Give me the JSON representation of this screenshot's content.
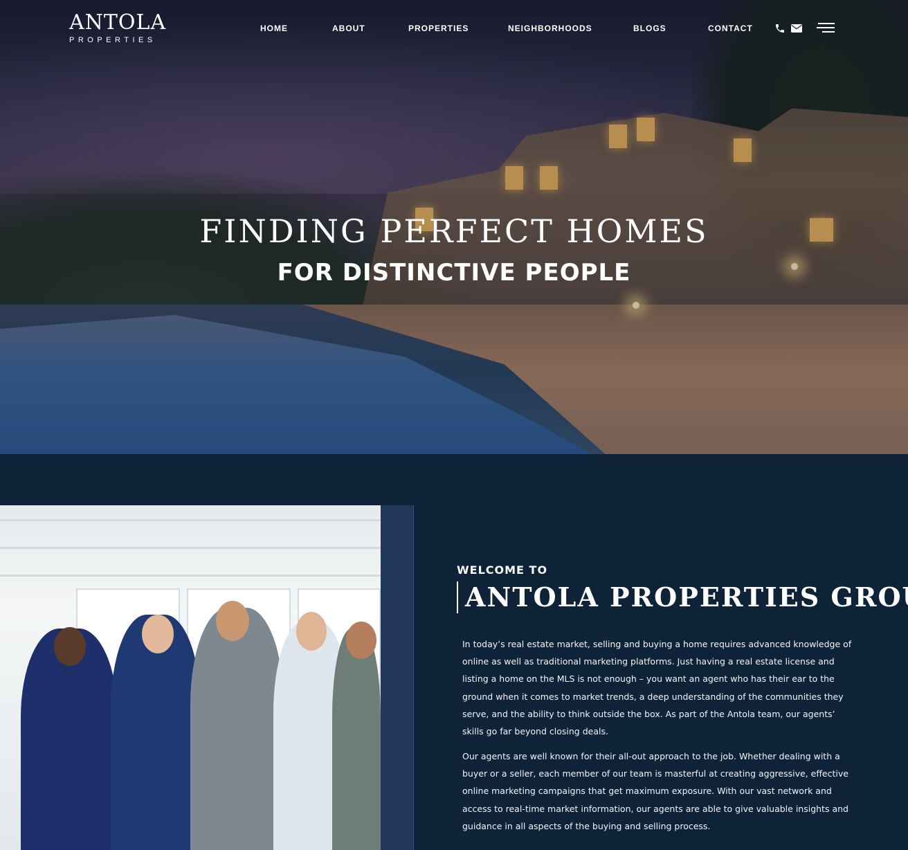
{
  "nav": {
    "logo_main": "ANTOLA",
    "logo_sub": "PROPERTIES",
    "links": [
      "HOME",
      "ABOUT",
      "PROPERTIES",
      "NEIGHBORHOODS",
      "BLOGS",
      "CONTACT"
    ],
    "icons": [
      "phone-icon",
      "mail-icon",
      "menu-icon"
    ]
  },
  "hero": {
    "title": "FINDING PERFECT HOMES",
    "subtitle": "FOR DISTINCTIVE PEOPLE"
  },
  "about": {
    "welcome": "WELCOME TO",
    "title": "ANTOLA PROPERTIES GROUP",
    "paragraph1": "In today’s real estate market, selling and buying a home requires advanced knowledge of online as well as traditional marketing platforms. Just having a real estate license and listing a home on the MLS is not enough – you want an agent who has their ear to the ground when it comes to market trends, a deep understanding of the communities they serve, and the ability to think outside the box. As part of the Antola team, our agents’ skills go far beyond closing deals.",
    "paragraph2": "Our agents are well known for their all-out approach to the job. Whether dealing with a buyer or a seller, each member of our team is masterful at creating aggressive, effective online marketing campaigns that get maximum exposure. With our vast network and access to real-time market information, our agents are able to give valuable insights and guidance in all aspects of the buying and selling process."
  },
  "colors": {
    "navy": "#0f2338",
    "accent_panel": "#22385a"
  }
}
